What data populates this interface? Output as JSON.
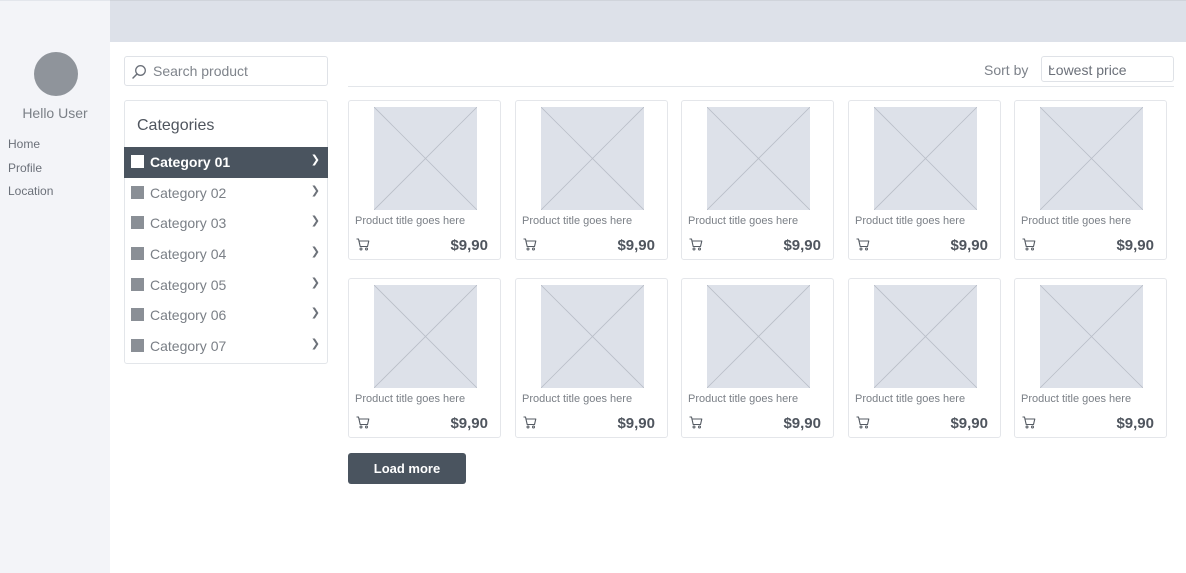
{
  "sidebar": {
    "greeting": "Hello User",
    "nav": [
      {
        "label": "Home"
      },
      {
        "label": "Profile"
      },
      {
        "label": "Location"
      }
    ]
  },
  "search": {
    "placeholder": "Search product",
    "value": ""
  },
  "categories": {
    "title": "Categories",
    "items": [
      {
        "label": "Category 01",
        "active": true
      },
      {
        "label": "Category 02",
        "active": false
      },
      {
        "label": "Category 03",
        "active": false
      },
      {
        "label": "Category 04",
        "active": false
      },
      {
        "label": "Category 05",
        "active": false
      },
      {
        "label": "Category 06",
        "active": false
      },
      {
        "label": "Category 07",
        "active": false
      }
    ]
  },
  "sort": {
    "label": "Sort by",
    "selected": "Lowest price"
  },
  "products": [
    {
      "title": "Product title goes here",
      "price": "$9,90"
    },
    {
      "title": "Product title goes here",
      "price": "$9,90"
    },
    {
      "title": "Product title goes here",
      "price": "$9,90"
    },
    {
      "title": "Product title goes here",
      "price": "$9,90"
    },
    {
      "title": "Product title goes here",
      "price": "$9,90"
    },
    {
      "title": "Product title goes here",
      "price": "$9,90"
    },
    {
      "title": "Product title goes here",
      "price": "$9,90"
    },
    {
      "title": "Product title goes here",
      "price": "$9,90"
    },
    {
      "title": "Product title goes here",
      "price": "$9,90"
    },
    {
      "title": "Product title goes here",
      "price": "$9,90"
    }
  ],
  "load_more_label": "Load more",
  "icons": {
    "search": "search-icon",
    "cart": "cart-icon",
    "chevron_right": "chevron-right-icon",
    "chevron_down": "chevron-down-icon",
    "image_placeholder": "image-placeholder-icon"
  },
  "colors": {
    "accent_dark": "#4a545f",
    "header_bar": "#dde1e9",
    "sidebar_bg": "#f3f4f8",
    "placeholder_gray": "#8f949b"
  }
}
